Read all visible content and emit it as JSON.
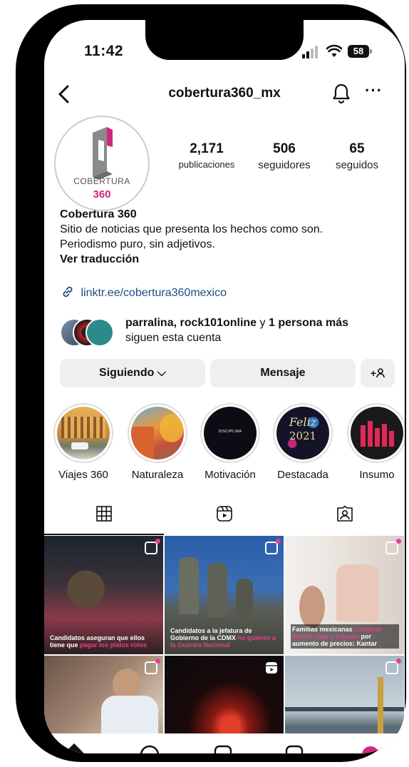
{
  "status": {
    "time": "11:42",
    "battery": "58"
  },
  "header": {
    "username": "cobertura360_mx",
    "more": "···"
  },
  "profile": {
    "avatar_text": "COBERTURA",
    "avatar_number": "360",
    "stats": [
      {
        "value": "2,171",
        "label": "publicaciones"
      },
      {
        "value": "506",
        "label": "seguidores"
      },
      {
        "value": "65",
        "label": "seguidos"
      }
    ],
    "name": "Cobertura 360",
    "bio": "Sitio de noticias que presenta los hechos como son.\nPeriodismo puro, sin adjetivos.",
    "translate": "Ver traducción",
    "link": "linktr.ee/cobertura360mexico",
    "followed_by_names": "parralina, rock101online",
    "followed_by_connector": " y ",
    "followed_by_more": "1 persona más",
    "followed_by_suffix": "siguen esta cuenta"
  },
  "actions": {
    "following": "Siguiendo ⌵",
    "message": "Mensaje",
    "add_user": "+"
  },
  "highlights": [
    {
      "label": "Viajes 360",
      "icon": "building-photo"
    },
    {
      "label": "Naturaleza",
      "icon": "street-photo"
    },
    {
      "label": "Motivación",
      "icon": "dark-cover"
    },
    {
      "label": "Destacada",
      "icon": "feliz-2021"
    },
    {
      "label": "Insumo",
      "icon": "bar-chart-cover"
    }
  ],
  "highlight_text": {
    "motivacion_cover": "DISCIPLINA",
    "feliz": "Feliz",
    "year": "2021"
  },
  "tabs": [
    "grid-icon",
    "reels-icon",
    "tagged-icon"
  ],
  "posts": [
    {
      "caption_white": "Candidatos aseguran que ellos tiene que ",
      "caption_pink": "pagar los platos rotos",
      "theme": "rally"
    },
    {
      "caption_white": "Candidatos a la jefatura de Gobierno de la CDMX ",
      "caption_pink": "no quieren a la Guardia Nacional",
      "theme": "soldiers"
    },
    {
      "caption_white": "Familias mexicanas ",
      "caption_pink": "compran menos ropa y calzado",
      "caption_white2": " por aumento de precios: Kantar",
      "theme": "clothes"
    },
    {
      "caption_white": "",
      "caption_pink": "",
      "theme": "speaker"
    },
    {
      "caption_white": "",
      "caption_pink": "",
      "theme": "volcano"
    },
    {
      "caption_white": "",
      "caption_pink": "",
      "theme": "bridge"
    }
  ],
  "colors": {
    "accent_pink": "#d4267e",
    "link_blue": "#1d4d82",
    "button_gray": "#efefef"
  }
}
